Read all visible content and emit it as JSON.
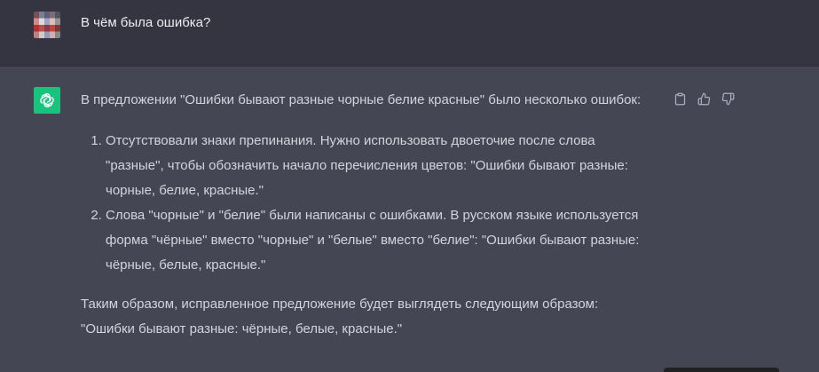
{
  "user_message": {
    "text": "В чём была ошибка?"
  },
  "assistant_message": {
    "intro": "В предложении \"Ошибки бывают разные чорные белие красные\" было несколько ошибок:",
    "list_items": [
      "Отсутствовали знаки препинания. Нужно использовать двоеточие после слова \"разные\", чтобы обозначить начало перечисления цветов: \"Ошибки бывают разные: чорные, белие, красные.\"",
      "Слова \"чорные\" и \"белие\" были написаны с ошибками. В русском языке используется форма \"чёрные\" вместо \"чорные\" и \"белые\" вместо \"белие\": \"Ошибки бывают разные: чёрные, белые, красные.\""
    ],
    "conclusion": "Таким образом, исправленное предложение будет выглядеть следующим образом: \"Ошибки бывают разные: чёрные, белые, красные.\""
  },
  "icons": {
    "assistant_avatar": "openai-logo-icon",
    "copy": "clipboard-icon",
    "like": "thumbs-up-icon",
    "dislike": "thumbs-down-icon"
  },
  "colors": {
    "user_bg": "#343541",
    "assistant_bg": "#444654",
    "avatar_green": "#19c37d",
    "text": "#d1d5db"
  }
}
